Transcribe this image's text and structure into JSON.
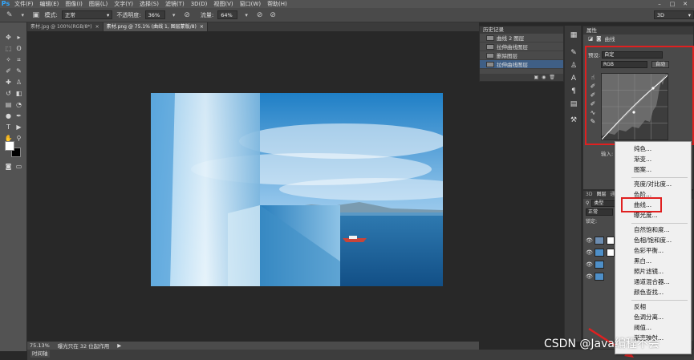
{
  "app": {
    "logo": "Ps"
  },
  "menubar": {
    "items": [
      "文件(F)",
      "编辑(E)",
      "图像(I)",
      "图层(L)",
      "文字(Y)",
      "选择(S)",
      "滤镜(T)",
      "3D(D)",
      "视图(V)",
      "窗口(W)",
      "帮助(H)"
    ],
    "window_controls": [
      "–",
      "□",
      "✕"
    ]
  },
  "options_bar": {
    "mode_label": "模式:",
    "mode_value": "正常",
    "opacity_label": "不透明度:",
    "opacity_value": "36%",
    "flow_label": "流量:",
    "flow_value": "64%",
    "workspace_value": "3D"
  },
  "tabs": [
    {
      "label": "素材.jpg @ 100%(RGB/8*)",
      "close": "×",
      "active": false
    },
    {
      "label": "素材.png @ 75.1% (曲线 1, 图层蒙版/8)",
      "close": "×",
      "active": true
    }
  ],
  "history_panel": {
    "title": "历史记录",
    "items": [
      {
        "label": "曲线 2 图层",
        "active": false
      },
      {
        "label": "拉伸曲线图层",
        "active": false
      },
      {
        "label": "删除图层",
        "active": false
      },
      {
        "label": "拉伸曲线图层",
        "active": true
      }
    ]
  },
  "properties_panel": {
    "title": "属性",
    "subtitle": "曲线",
    "preset_label": "预设:",
    "preset_value": "自定",
    "channel_value": "RGB",
    "auto_button": "自动",
    "input_label": "输入:"
  },
  "layers_panel": {
    "tabs": [
      "3D",
      "图层",
      "通道",
      "路径"
    ],
    "filter_value": "类型",
    "blend_value": "正常",
    "lock_label": "锁定:"
  },
  "status_bar": {
    "zoom": "75.13%",
    "info": "曝光只在 32 位起作用"
  },
  "timeline": {
    "label": "时间轴"
  },
  "adjustment_menu": {
    "groups": [
      [
        "纯色...",
        "渐变...",
        "图案..."
      ],
      [
        "亮度/对比度...",
        "色阶...",
        "曲线...",
        "曝光度..."
      ],
      [
        "自然饱和度...",
        "色相/饱和度...",
        "色彩平衡...",
        "黑白...",
        "照片滤镜...",
        "通道混合器...",
        "颜色查找..."
      ],
      [
        "反相",
        "色调分离...",
        "阈值...",
        "渐变映射..."
      ]
    ]
  },
  "watermark": "CSDN @Java编程不会",
  "colors": {
    "highlight": "#e02020",
    "panel": "#4a4a4a",
    "workspace": "#282828",
    "history_active": "#3f5f86"
  }
}
